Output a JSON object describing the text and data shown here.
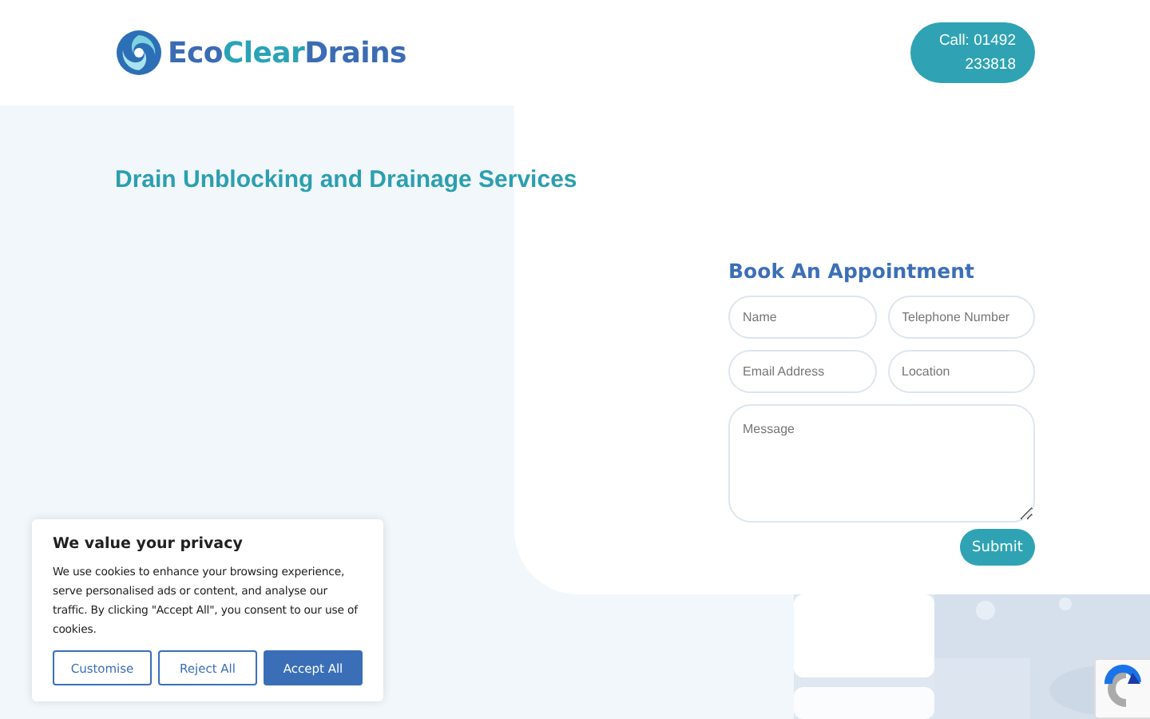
{
  "header": {
    "logo_parts": [
      "Eco",
      "Clear",
      "Drains"
    ],
    "call_button": "Call: 01492 233818"
  },
  "hero": {
    "title": "Drain Unblocking and Drainage Services"
  },
  "booking_form": {
    "title": "Book An Appointment",
    "fields": [
      {
        "placeholder": "Name"
      },
      {
        "placeholder": "Telephone Number"
      },
      {
        "placeholder": "Email Address"
      },
      {
        "placeholder": "Location"
      }
    ],
    "message": {
      "placeholder": "Message"
    },
    "submit": "Submit"
  },
  "cookie_banner": {
    "title": "We value your privacy",
    "text": "We use cookies to enhance your browsing experience, serve personalised ads or content, and analyse our traffic. By clicking \"Accept All\", you consent to our use of cookies.",
    "buttons": [
      {
        "label": "Customise",
        "kind": "outline"
      },
      {
        "label": "Reject All",
        "kind": "outline"
      },
      {
        "label": "Accept All",
        "kind": "primary"
      }
    ]
  }
}
